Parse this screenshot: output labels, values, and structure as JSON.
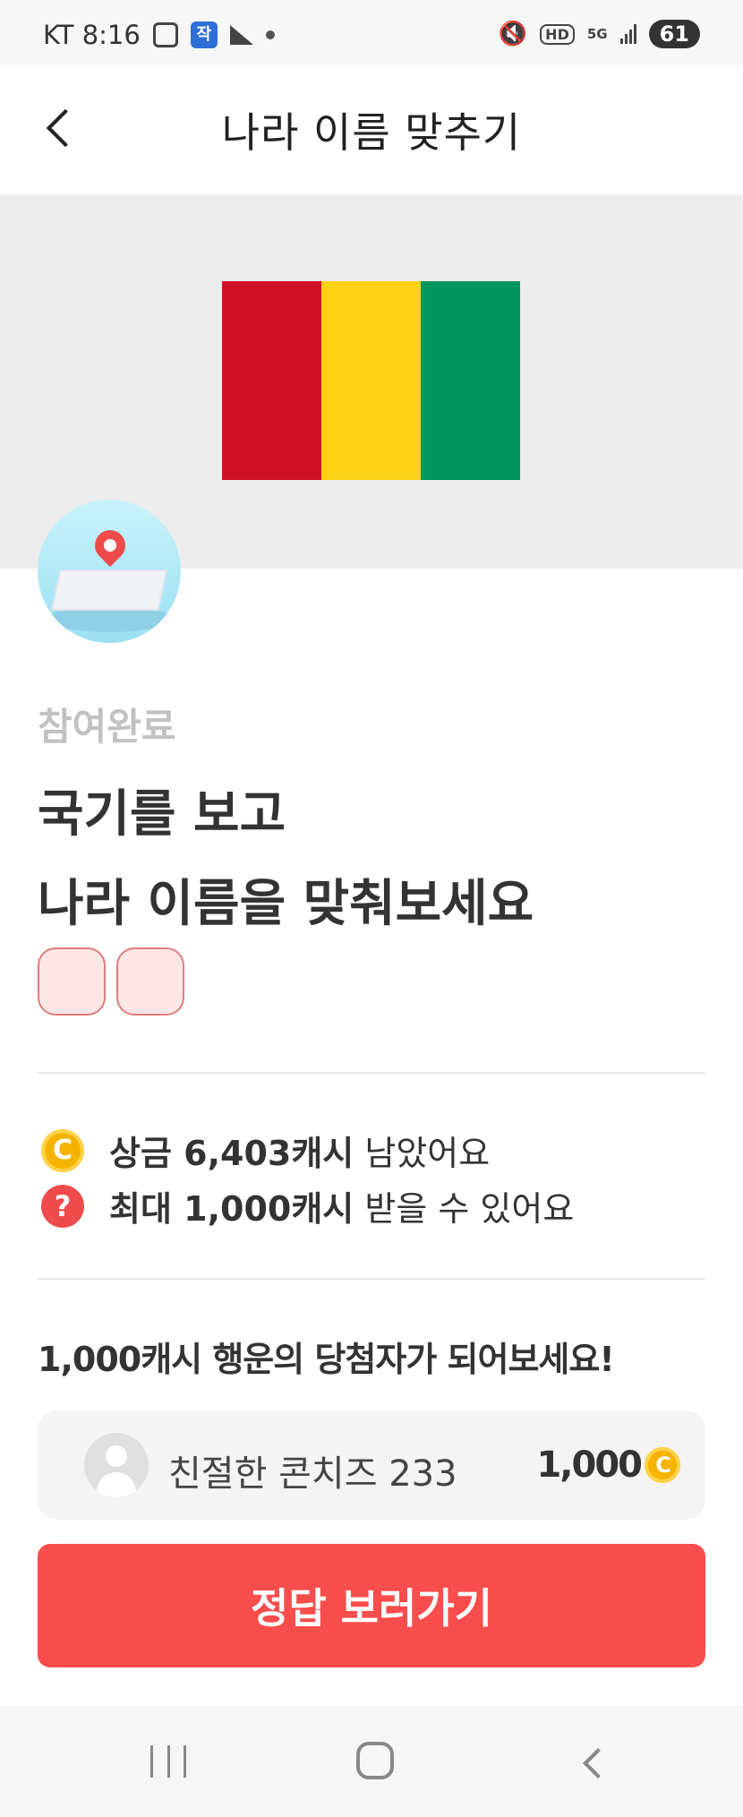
{
  "status_bar": {
    "carrier_time": "KT 8:16",
    "badge_text": "작",
    "hd": "HD",
    "network": "5G",
    "battery": "61"
  },
  "header": {
    "title": "나라 이름 맞추기"
  },
  "flag": {
    "colors": [
      "#ce1126",
      "#fcd116",
      "#009460"
    ]
  },
  "quiz": {
    "status": "참여완료",
    "headline_line1": "국기를 보고",
    "headline_line2": "나라 이름을 맞춰보세요",
    "answer_box_count": 2
  },
  "info": {
    "prize_bold": "상금 6,403캐시",
    "prize_rest": " 남았어요",
    "max_bold": "최대 1,000캐시",
    "max_rest": " 받을 수 있어요",
    "coin_symbol": "C",
    "question_symbol": "?"
  },
  "winner": {
    "title": "1,000캐시 행운의 당첨자가 되어보세요!",
    "name": "친절한 콘치즈 233",
    "amount": "1,000"
  },
  "cta": {
    "label": "정답 보러가기"
  },
  "colors": {
    "accent": "#f84d4d",
    "coin": "#f6b400"
  }
}
